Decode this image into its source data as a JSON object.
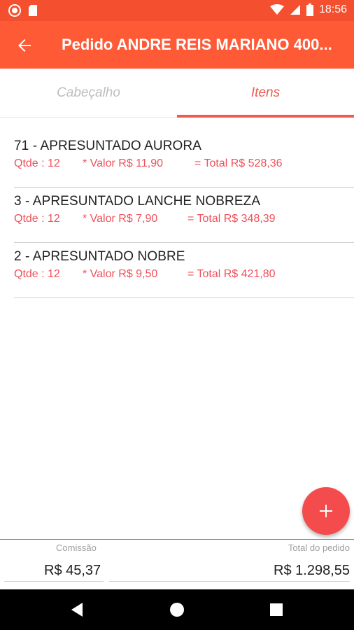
{
  "status_bar": {
    "time": "18:56",
    "icons": [
      "record-icon",
      "sd-card-icon",
      "wifi-icon",
      "signal-icon",
      "battery-icon"
    ]
  },
  "app_bar": {
    "back_icon": "arrow-back-icon",
    "title": "Pedido ANDRE REIS MARIANO 400..."
  },
  "tabs": [
    {
      "label": "Cabeçalho",
      "selected": false
    },
    {
      "label": "Itens",
      "selected": true
    }
  ],
  "items": [
    {
      "name": "71 - APRESUNTADO AURORA",
      "qty": "Qtde : 12",
      "value": "* Valor R$ 11,90",
      "total": "= Total R$ 528,36"
    },
    {
      "name": "3 - APRESUNTADO LANCHE NOBREZA",
      "qty": "Qtde : 12",
      "value": "* Valor R$ 7,90",
      "total": "= Total R$ 348,39"
    },
    {
      "name": "2 - APRESUNTADO NOBRE",
      "qty": "Qtde : 12",
      "value": "* Valor R$ 9,50",
      "total": "= Total R$ 421,80"
    }
  ],
  "fab": {
    "icon": "plus-icon"
  },
  "footer": {
    "commission_label": "Comissão",
    "commission_value": "R$ 45,37",
    "total_label": "Total do pedido",
    "total_value": "R$ 1.298,55"
  },
  "nav_bar": {
    "icons": [
      "back-triangle-icon",
      "home-circle-icon",
      "recents-square-icon"
    ]
  },
  "colors": {
    "status_bar": "#f4502f",
    "app_bar": "#ff5a36",
    "accent": "#f05a4f",
    "fab": "#f44c4c"
  }
}
